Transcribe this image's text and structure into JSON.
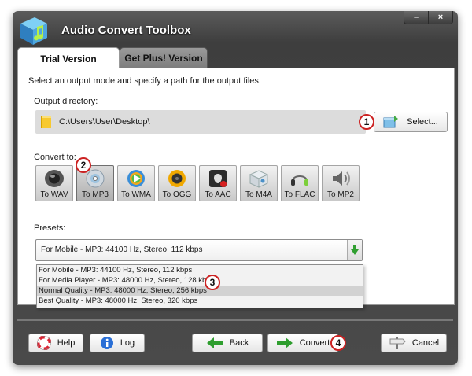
{
  "window": {
    "title": "Audio Convert Toolbox",
    "minimize": "–",
    "close": "×"
  },
  "tabs": [
    {
      "label": "Trial Version",
      "active": true
    },
    {
      "label": "Get Plus! Version",
      "active": false
    }
  ],
  "main": {
    "instruction": "Select an output mode and specify a path for the output files.",
    "output_label": "Output directory:",
    "output_path": "C:\\Users\\User\\Desktop\\",
    "select_button": "Select...",
    "convert_label": "Convert to:",
    "formats": [
      "To WAV",
      "To MP3",
      "To WMA",
      "To OGG",
      "To AAC",
      "To M4A",
      "To FLAC",
      "To MP2"
    ],
    "selected_format": "To MP3",
    "presets_label": "Presets:",
    "preset_selected": "For Mobile - MP3: 44100 Hz, Stereo, 112 kbps",
    "preset_options": [
      "For Mobile - MP3: 44100 Hz, Stereo, 112 kbps",
      "For Media Player - MP3: 48000 Hz, Stereo, 128 kbps",
      "Normal Quality - MP3: 48000 Hz, Stereo, 256 kbps",
      "Best Quality - MP3: 48000 Hz, Stereo, 320 kbps"
    ]
  },
  "callouts": [
    "1",
    "2",
    "3",
    "4"
  ],
  "footer": {
    "help": "Help",
    "log": "Log",
    "back": "Back",
    "convert": "Convert",
    "cancel": "Cancel"
  },
  "colors": {
    "title_bar": "#3e3e3e",
    "callout_ring": "#cc2222",
    "arrow_green": "#2f9e2f"
  }
}
